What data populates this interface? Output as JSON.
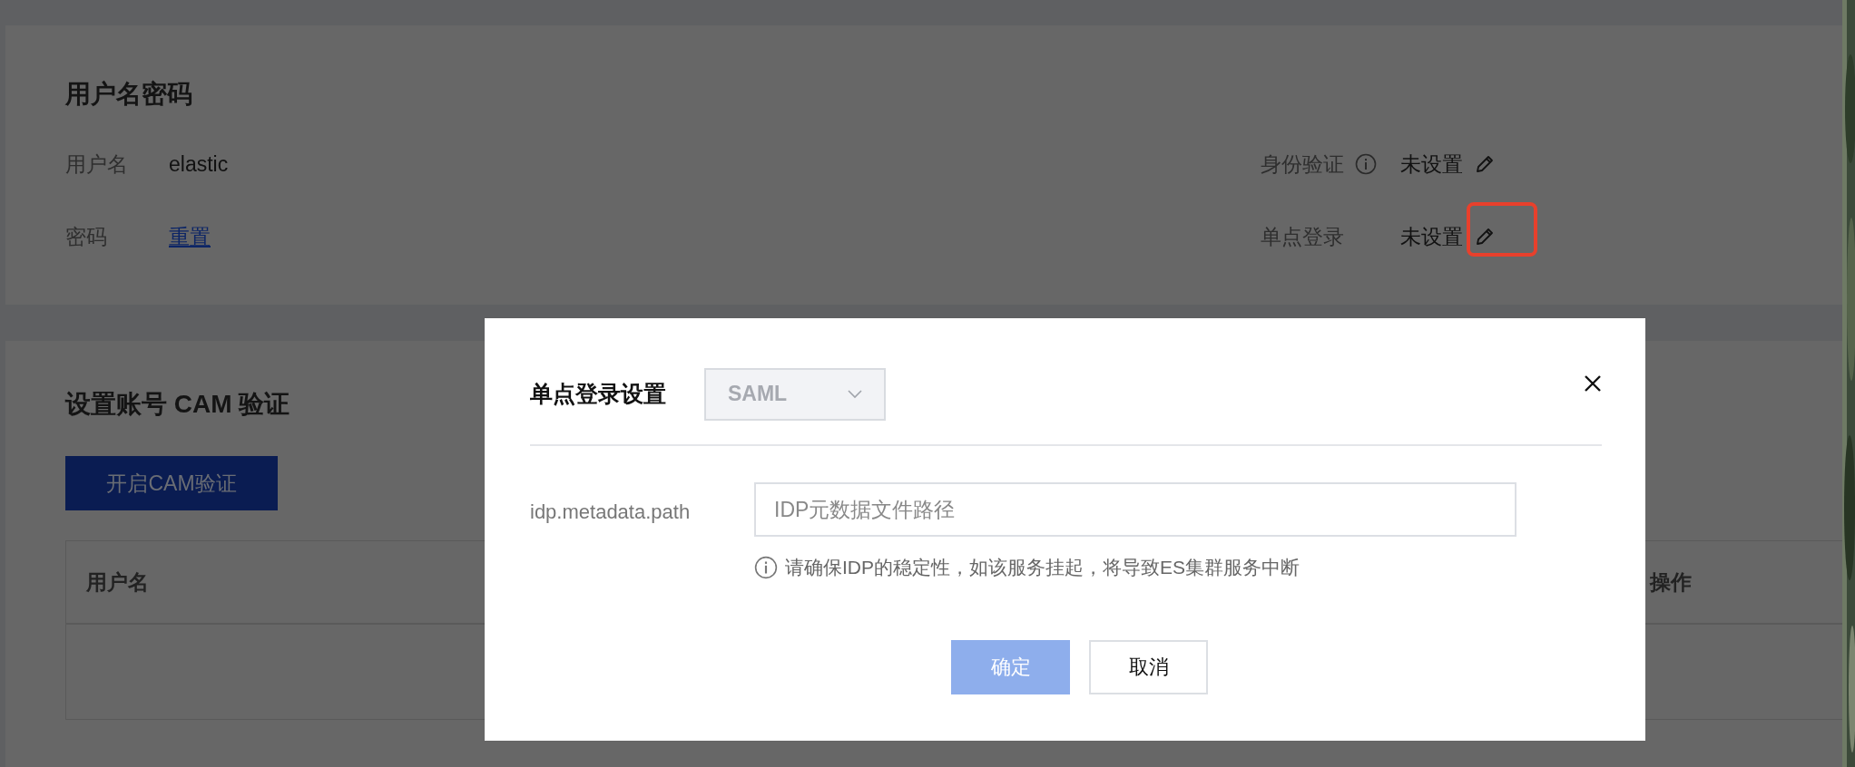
{
  "account_card": {
    "title": "用户名密码",
    "fields": [
      {
        "label": "用户名",
        "value": "elastic",
        "kind": "text"
      },
      {
        "label": "密码",
        "value": "重置",
        "kind": "link"
      }
    ],
    "settings": [
      {
        "label": "身份验证",
        "info": true,
        "value": "未设置",
        "highlighted": false
      },
      {
        "label": "单点登录",
        "info": false,
        "value": "未设置",
        "highlighted": true
      }
    ]
  },
  "cam_card": {
    "title": "设置账号 CAM 验证",
    "button": "开启CAM验证",
    "table": {
      "columns": [
        "用户名",
        "操作"
      ]
    }
  },
  "dialog": {
    "title": "单点登录设置",
    "protocol": {
      "value": "SAML",
      "disabled": true
    },
    "fields": [
      {
        "label": "idp.metadata.path",
        "placeholder": "IDP元数据文件路径",
        "hint": "请确保IDP的稳定性，如该服务挂起，将导致ES集群服务中断"
      }
    ],
    "buttons": [
      {
        "label": "确定",
        "kind": "primary",
        "disabled": true
      },
      {
        "label": "取消",
        "kind": "default",
        "disabled": false
      }
    ]
  }
}
